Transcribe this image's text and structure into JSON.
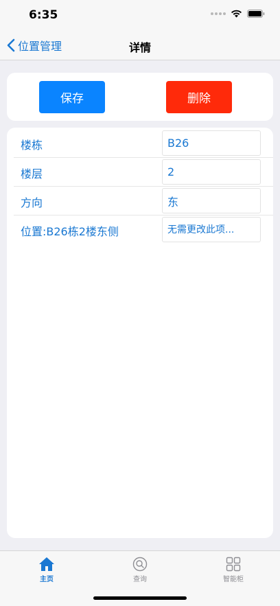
{
  "status_bar": {
    "time": "6:35"
  },
  "nav": {
    "back_label": "位置管理",
    "title": "详情"
  },
  "actions": {
    "save_label": "保存",
    "delete_label": "删除",
    "save_color": "#0a84ff",
    "delete_color": "#ff2a0a"
  },
  "fields": [
    {
      "label": "楼栋",
      "value": "B26"
    },
    {
      "label": "楼层",
      "value": "2"
    },
    {
      "label": "方向",
      "value": "东"
    },
    {
      "label": "位置:B26栋2楼东侧",
      "value": "",
      "placeholder": "无需更改此项..."
    }
  ],
  "tabs": [
    {
      "label": "主页",
      "icon": "home-icon",
      "active": true
    },
    {
      "label": "查询",
      "icon": "search-icon",
      "active": false
    },
    {
      "label": "智能柜",
      "icon": "grid-icon",
      "active": false
    }
  ],
  "colors": {
    "accent": "#1a78d2",
    "background": "#efeff4"
  }
}
